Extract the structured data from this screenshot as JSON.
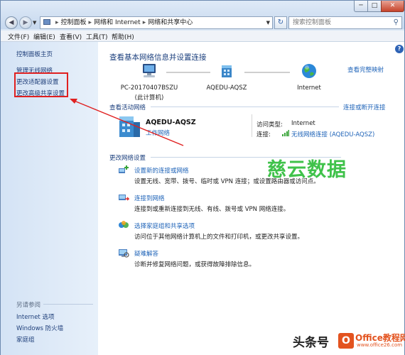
{
  "window": {
    "controls": {
      "minimize": "─",
      "maximize": "□",
      "close": "✕"
    }
  },
  "address": {
    "crumbs": [
      "控制面板",
      "网络和 Internet",
      "网络和共享中心"
    ],
    "separator": "▸",
    "search_placeholder": "搜索控制面板"
  },
  "menu": [
    "文件(F)",
    "编辑(E)",
    "查看(V)",
    "工具(T)",
    "帮助(H)"
  ],
  "sidebar": {
    "home": "控制面板主页",
    "links": [
      "管理无线网络",
      "更改适配器设置",
      "更改高级共享设置"
    ],
    "see_also": "另请参阅",
    "see_also_links": [
      "Internet 选项",
      "Windows 防火墙",
      "家庭组"
    ]
  },
  "main": {
    "title": "查看基本网络信息并设置连接",
    "view_full_map": "查看完整映射",
    "nodes": [
      {
        "name": "PC-20170407BSZU",
        "sub": "(此计算机)",
        "icon": "computer-icon"
      },
      {
        "name": "AQEDU-AQSZ",
        "sub": "",
        "icon": "network-icon"
      },
      {
        "name": "Internet",
        "sub": "",
        "icon": "globe-icon"
      }
    ],
    "active_networks_label": "查看活动网络",
    "connect_disconnect": "连接或断开连接",
    "network": {
      "name": "AQEDU-AQSZ",
      "type": "工作网络",
      "access_type_label": "访问类型:",
      "access_type_value": "Internet",
      "connection_label": "连接:",
      "connection_value": "无线网络连接 (AQEDU-AQSZ)"
    },
    "change_settings_label": "更改网络设置",
    "tasks": [
      {
        "link": "设置新的连接或网络",
        "desc": "设置无线、宽带、拨号、临时或 VPN 连接；或设置路由器或访问点。",
        "icon": "new-connection-icon"
      },
      {
        "link": "连接到网络",
        "desc": "连接到或重新连接到无线、有线、拨号或 VPN 网络连接。",
        "icon": "connect-network-icon"
      },
      {
        "link": "选择家庭组和共享选项",
        "desc": "访问位于其他网络计算机上的文件和打印机，或更改共享设置。",
        "icon": "homegroup-icon"
      },
      {
        "link": "疑难解答",
        "desc": "诊断并修复网络问题，或获得故障排除信息。",
        "icon": "troubleshoot-icon"
      }
    ]
  },
  "watermark": {
    "text": "慈云数据",
    "toutiao": "头条号",
    "office_title": "Office教程网",
    "office_url": "www.office26.com",
    "office_badge": "O"
  },
  "colors": {
    "annotation_red": "#e02020",
    "link_blue": "#1e63b8",
    "watermark_green": "#3fc24a"
  }
}
